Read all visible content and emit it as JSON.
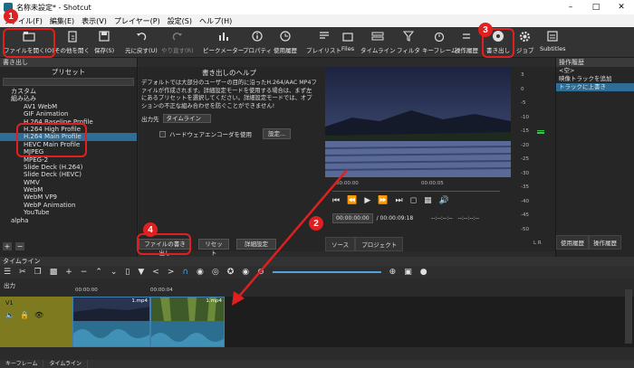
{
  "window": {
    "title": "名称未設定* - Shotcut"
  },
  "menu": [
    "ファイル(F)",
    "編集(E)",
    "表示(V)",
    "プレイヤー(P)",
    "設定(S)",
    "ヘルプ(H)"
  ],
  "toolbar": {
    "open_file": "ファイルを開く(O)",
    "open_other": "その他を開く",
    "save": "保存(S)",
    "undo": "元に戻す(U)",
    "redo": "やり直す(R)",
    "peak_meter": "ピークメーター",
    "properties": "プロパティ",
    "recent": "使用履歴",
    "playlist": "プレイリスト",
    "files": "Files",
    "timeline": "タイムライン",
    "filters": "フィルタ",
    "keyframes": "キーフレーム",
    "history": "操作履歴",
    "export": "書き出し",
    "jobs": "ジョブ",
    "subtitles": "Subtitles"
  },
  "export_panel": {
    "title": "書き出し",
    "presets_header": "プリセット",
    "presets": [
      {
        "label": "カスタム",
        "level": 0
      },
      {
        "label": "組み込み",
        "level": 0
      },
      {
        "label": "AV1 WebM",
        "level": 1
      },
      {
        "label": "GIF Animation",
        "level": 1
      },
      {
        "label": "H.264 Baseline Profile",
        "level": 1
      },
      {
        "label": "H.264 High Profile",
        "level": 1
      },
      {
        "label": "H.264 Main Profile",
        "level": 1,
        "selected": true
      },
      {
        "label": "HEVC Main Profile",
        "level": 1
      },
      {
        "label": "MJPEG",
        "level": 1
      },
      {
        "label": "MPEG-2",
        "level": 1
      },
      {
        "label": "Slide Deck (H.264)",
        "level": 1
      },
      {
        "label": "Slide Deck (HEVC)",
        "level": 1
      },
      {
        "label": "WMV",
        "level": 1
      },
      {
        "label": "WebM",
        "level": 1
      },
      {
        "label": "WebM VP9",
        "level": 1
      },
      {
        "label": "WebP Animation",
        "level": 1
      },
      {
        "label": "YouTube",
        "level": 1
      },
      {
        "label": "alpha",
        "level": 0
      }
    ],
    "add": "+",
    "remove": "−",
    "help_title": "書き出しのヘルプ",
    "help_text": "デフォルトでは大部分のユーザーの目的に沿ったH.264/AAC MP4ファイルが作成されます。詳細設定モードを使用する場合は、まず左にあるプリセットを選択してください。詳細設定モードでは、オプションの不正な組み合わせを防ぐことができません!",
    "output_label": "出力先",
    "output_value": "タイムライン",
    "hw_encoder": "ハードウェアエンコーダを使用",
    "settings": "設定...",
    "export_file": "ファイルの書き出し",
    "reset": "リセット",
    "advanced": "詳細設定"
  },
  "player": {
    "scrub_start": "00:00:00",
    "scrub_mid": "00:00:05",
    "current_time": "00:00:00:00",
    "duration": "/ 00:00:09:18",
    "in_point": "--:--:--:--",
    "out_point": "--:--:--:--",
    "tab_source": "ソース",
    "tab_project": "プロジェクト"
  },
  "meter": {
    "marks": [
      "3",
      "0",
      "-5",
      "-10",
      "-15",
      "-20",
      "-25",
      "-30",
      "-35",
      "-40",
      "-45",
      "-50"
    ],
    "lr": "L R"
  },
  "history_panel": {
    "title": "操作履歴",
    "items": [
      {
        "label": "<空>"
      },
      {
        "label": "映像トラックを追加"
      },
      {
        "label": "トラックに上書き",
        "selected": true
      }
    ],
    "tab_recent": "使用履歴",
    "tab_history": "操作履歴"
  },
  "timeline": {
    "title": "タイムライン",
    "output_label": "出力",
    "ruler_0": "00:00:00",
    "ruler_1": "00:00:04",
    "track_name": "V1",
    "clip_1": "1.mp4",
    "clip_2": "1.mp4"
  },
  "bottom_tabs": [
    "キーフレーム",
    "タイムライン"
  ],
  "annotations": [
    "1",
    "2",
    "3",
    "4"
  ],
  "colors": {
    "accent": "#e02020",
    "selection": "#2e6d95",
    "track": "#7d7a1f",
    "clip": "#2c6e8f"
  }
}
